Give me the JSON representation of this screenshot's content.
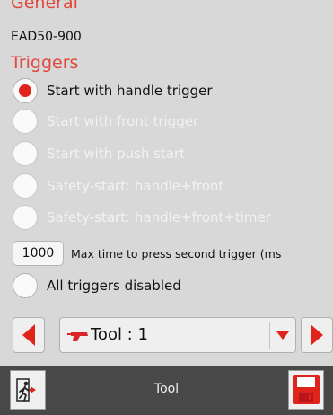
{
  "general": {
    "heading": "General",
    "model": "EAD50-900"
  },
  "triggers": {
    "heading": "Triggers",
    "options": [
      {
        "label": "Start with handle trigger",
        "selected": true,
        "enabled": true
      },
      {
        "label": "Start with front trigger",
        "selected": false,
        "enabled": false
      },
      {
        "label": "Start with push start",
        "selected": false,
        "enabled": false
      },
      {
        "label": "Safety-start: handle+front",
        "selected": false,
        "enabled": false
      },
      {
        "label": "Safety-start: handle+front+timer",
        "selected": false,
        "enabled": false
      }
    ],
    "max_time": {
      "value": "1000",
      "label": "Max time to press second trigger (ms"
    },
    "disabled_option": {
      "label": "All triggers disabled",
      "selected": false,
      "enabled": true
    }
  },
  "tool_nav": {
    "selected": "Tool : 1",
    "prev_icon": "arrow-left-icon",
    "next_icon": "arrow-right-icon",
    "tool_icon": "screwdriver-icon",
    "dropdown_icon": "chevron-down-icon"
  },
  "bottom_bar": {
    "title": "Tool",
    "exit_icon": "exit-icon",
    "save_icon": "floppy-disk-icon"
  },
  "colors": {
    "accent": "#e2473c",
    "radio_selected": "#e0241b",
    "disabled_text": "#f2f2f2",
    "background": "#d8d8d8",
    "bottom_bar": "#484848"
  }
}
